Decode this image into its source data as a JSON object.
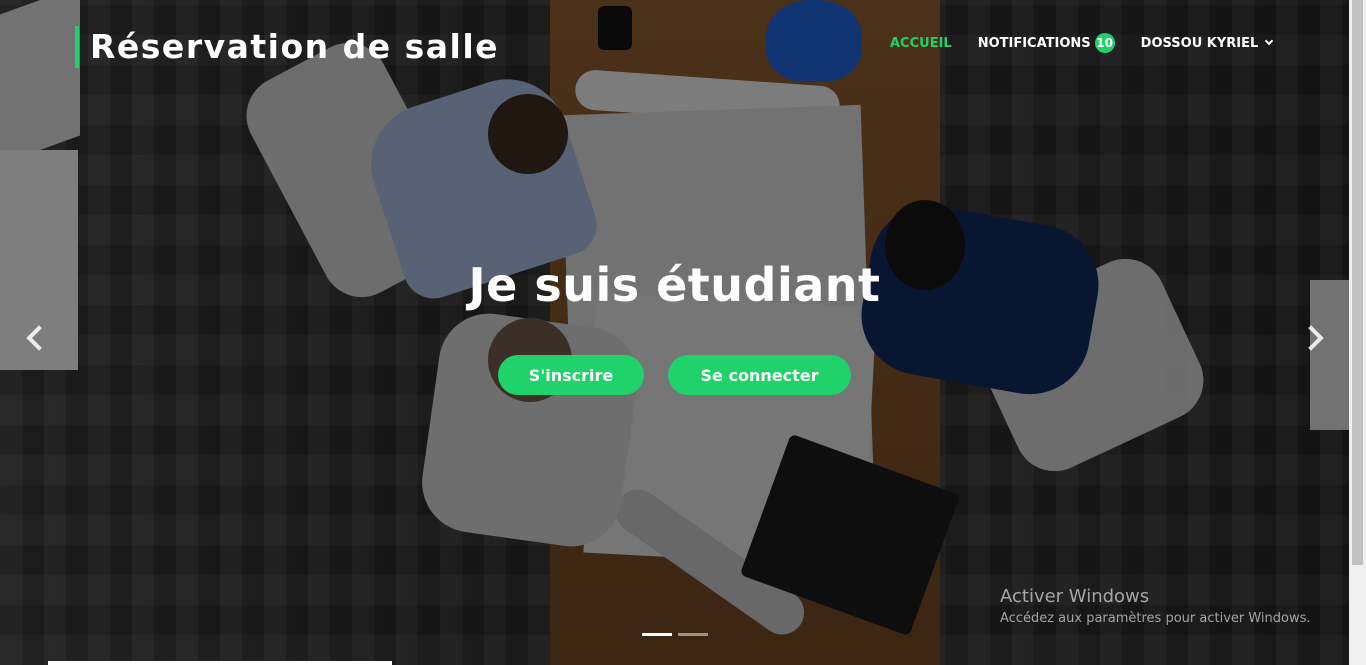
{
  "header": {
    "brand_title": "Réservation de salle",
    "accent_color": "#1fd36a"
  },
  "nav": {
    "home_label": "ACCUEIL",
    "notifications_label": "NOTIFICATIONS",
    "notifications_count": "10",
    "user_label": "DOSSOU KYRIEL",
    "user_menu_icon": "chevron-down-icon"
  },
  "hero": {
    "title": "Je suis étudiant",
    "register_label": "S'inscrire",
    "login_label": "Se connecter",
    "prev_icon": "chevron-left-icon",
    "next_icon": "chevron-right-icon",
    "slide_count": 2,
    "active_slide": 1
  },
  "watermark": {
    "title": "Activer Windows",
    "subtitle": "Accédez aux paramètres pour activer Windows."
  }
}
